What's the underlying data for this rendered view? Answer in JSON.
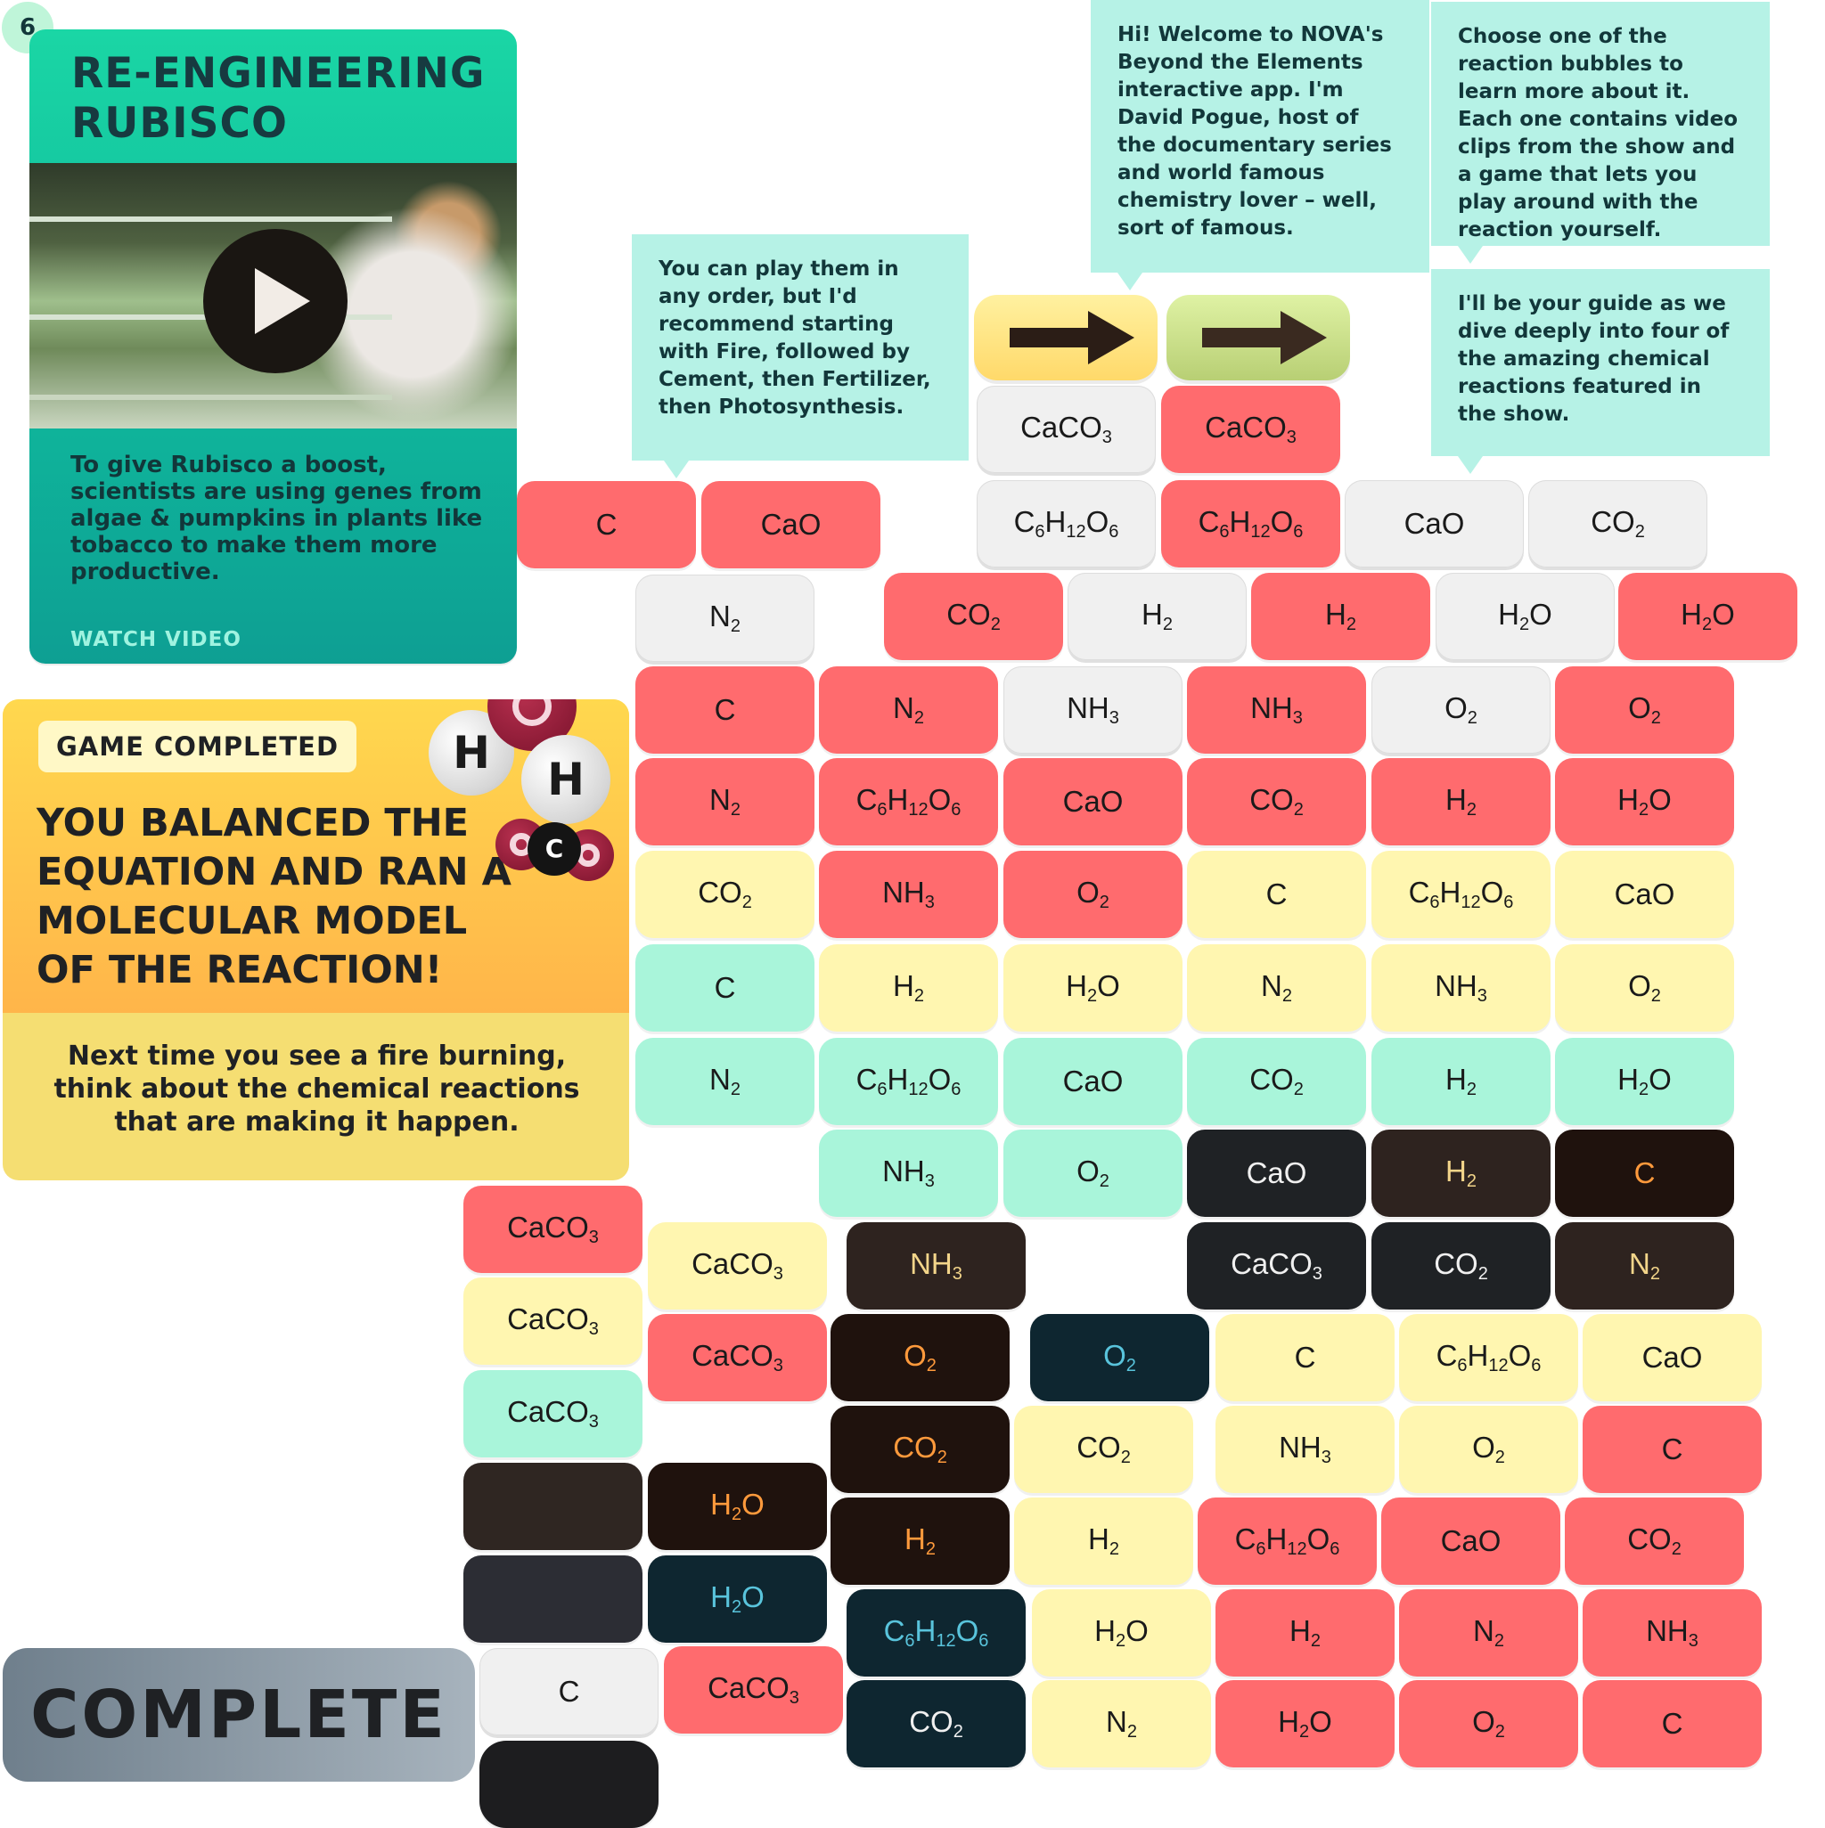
{
  "step_badge": "6",
  "video_card": {
    "title": "RE-ENGINEERING RUBISCO",
    "description": "To give Rubisco a boost, scientists are using genes from algae & pumpkins in plants like tobacco to make them more productive.",
    "watch_label": "WATCH VIDEO"
  },
  "game_card": {
    "badge": "GAME COMPLETED",
    "headline": "YOU BALANCED THE EQUATION AND RAN A MOLECULAR MODEL OF THE REACTION!",
    "body": "Next time you see a fire burning, think about the chemical reactions that are making it happen.",
    "molecules": {
      "h": "H",
      "c": "C"
    }
  },
  "complete_button": "COMPLETE",
  "bubbles": {
    "b1": [
      {
        "t": "You can play them in any order, but I'd recommend starting with "
      },
      {
        "t": "Fire",
        "b": true
      },
      {
        "t": ", followed by "
      },
      {
        "t": "Cement",
        "b": true
      },
      {
        "t": ", then "
      },
      {
        "t": "Fertilizer",
        "b": true
      },
      {
        "t": ", then "
      },
      {
        "t": "Photosynthesis",
        "b": true
      },
      {
        "t": "."
      }
    ],
    "b2": [
      {
        "t": "Hi! Welcome to NOVA's Beyond the Elements interactive app. I'm "
      },
      {
        "t": "David Pogue",
        "b": true
      },
      {
        "t": ", host of the documentary series and world famous chemistry lover – well, sort of famous."
      }
    ],
    "b3": [
      {
        "t": "Choose one of the reaction bubbles to learn more about it. Each one contains video clips from the show and a game that lets you play around with the reaction yourself."
      }
    ],
    "b4": [
      {
        "t": "I'll be your guide",
        "b": true
      },
      {
        "t": " as we dive deeply into four of the amazing chemical reactions featured in the show."
      }
    ]
  },
  "colors": {
    "red": "#ff6b6e",
    "gray": "#f0f0f0",
    "yellow": "#fff6b0",
    "mint": "#a9f5da",
    "charcoal": "#1f2225",
    "brown": "#2e231f",
    "dark_brown": "#1f120d",
    "navy": "#0e2630",
    "bubble": "#b6f2e6",
    "accent_teal": "#1ad6a5",
    "accent_orange": "#ffb54a"
  },
  "arrows": [
    {
      "icon": "right-arrow-icon",
      "style": "yellow"
    },
    {
      "icon": "right-arrow-icon",
      "style": "olive"
    }
  ],
  "tiles": [
    {
      "f": "CaCO3",
      "c": "gray"
    },
    {
      "f": "CaCO3",
      "c": "red"
    },
    {
      "f": "C6H12O6",
      "c": "gray"
    },
    {
      "f": "C6H12O6",
      "c": "red"
    },
    {
      "f": "CaO",
      "c": "gray"
    },
    {
      "f": "CO2",
      "c": "gray"
    },
    {
      "f": "C",
      "c": "red"
    },
    {
      "f": "CaO",
      "c": "red"
    },
    {
      "f": "N2",
      "c": "gray"
    },
    {
      "f": "CO2",
      "c": "red"
    },
    {
      "f": "H2",
      "c": "gray"
    },
    {
      "f": "H2",
      "c": "red"
    },
    {
      "f": "H2O",
      "c": "gray"
    },
    {
      "f": "H2O",
      "c": "red"
    },
    {
      "f": "C",
      "c": "red"
    },
    {
      "f": "N2",
      "c": "red"
    },
    {
      "f": "NH3",
      "c": "gray"
    },
    {
      "f": "NH3",
      "c": "red"
    },
    {
      "f": "O2",
      "c": "gray"
    },
    {
      "f": "O2",
      "c": "red"
    },
    {
      "f": "N2",
      "c": "red"
    },
    {
      "f": "C6H12O6",
      "c": "red"
    },
    {
      "f": "CaO",
      "c": "red"
    },
    {
      "f": "CO2",
      "c": "red"
    },
    {
      "f": "H2",
      "c": "red"
    },
    {
      "f": "H2O",
      "c": "red"
    },
    {
      "f": "CO2",
      "c": "yellow"
    },
    {
      "f": "NH3",
      "c": "red"
    },
    {
      "f": "O2",
      "c": "red"
    },
    {
      "f": "C",
      "c": "yellow"
    },
    {
      "f": "C6H12O6",
      "c": "yellow"
    },
    {
      "f": "CaO",
      "c": "yellow"
    },
    {
      "f": "C",
      "c": "mint"
    },
    {
      "f": "H2",
      "c": "yellow"
    },
    {
      "f": "H2O",
      "c": "yellow"
    },
    {
      "f": "N2",
      "c": "yellow"
    },
    {
      "f": "NH3",
      "c": "yellow"
    },
    {
      "f": "O2",
      "c": "yellow"
    },
    {
      "f": "N2",
      "c": "mint"
    },
    {
      "f": "C6H12O6",
      "c": "mint"
    },
    {
      "f": "CaO",
      "c": "mint"
    },
    {
      "f": "CO2",
      "c": "mint"
    },
    {
      "f": "H2",
      "c": "mint"
    },
    {
      "f": "H2O",
      "c": "mint"
    },
    {
      "f": "NH3",
      "c": "mint"
    },
    {
      "f": "O2",
      "c": "mint"
    },
    {
      "f": "CaO",
      "c": "charcoal"
    },
    {
      "f": "H2",
      "c": "brown"
    },
    {
      "f": "C",
      "c": "darkbrown"
    },
    {
      "f": "CaCO3",
      "c": "red"
    },
    {
      "f": "CaCO3",
      "c": "yellow"
    },
    {
      "f": "NH3",
      "c": "brown"
    },
    {
      "f": "CaCO3",
      "c": "charcoal"
    },
    {
      "f": "CO2",
      "c": "charcoal"
    },
    {
      "f": "N2",
      "c": "brown"
    },
    {
      "f": "CaCO3",
      "c": "yellow"
    },
    {
      "f": "CaCO3",
      "c": "red"
    },
    {
      "f": "O2",
      "c": "darkbrown"
    },
    {
      "f": "O2",
      "c": "navy"
    },
    {
      "f": "C",
      "c": "yellow"
    },
    {
      "f": "C6H12O6",
      "c": "yellow"
    },
    {
      "f": "CaO",
      "c": "yellow"
    },
    {
      "f": "CaCO3",
      "c": "mint"
    },
    {
      "f": "CO2",
      "c": "darkbrown"
    },
    {
      "f": "CO2",
      "c": "yellow"
    },
    {
      "f": "NH3",
      "c": "yellow"
    },
    {
      "f": "O2",
      "c": "yellow"
    },
    {
      "f": "C",
      "c": "red"
    },
    {
      "f": "",
      "c": "blank-brown"
    },
    {
      "f": "H2O",
      "c": "darkbrown"
    },
    {
      "f": "H2",
      "c": "darkbrown"
    },
    {
      "f": "H2",
      "c": "yellow"
    },
    {
      "f": "C6H12O6",
      "c": "red"
    },
    {
      "f": "CaO",
      "c": "red"
    },
    {
      "f": "CO2",
      "c": "red"
    },
    {
      "f": "",
      "c": "blank-slate"
    },
    {
      "f": "H2O",
      "c": "navy"
    },
    {
      "f": "C6H12O6",
      "c": "navy"
    },
    {
      "f": "H2O",
      "c": "yellow"
    },
    {
      "f": "H2",
      "c": "red"
    },
    {
      "f": "N2",
      "c": "red"
    },
    {
      "f": "NH3",
      "c": "red"
    },
    {
      "f": "C",
      "c": "gray"
    },
    {
      "f": "CaCO3",
      "c": "red"
    },
    {
      "f": "CO2",
      "c": "navywhite"
    },
    {
      "f": "N2",
      "c": "yellow"
    },
    {
      "f": "H2O",
      "c": "red"
    },
    {
      "f": "O2",
      "c": "red"
    },
    {
      "f": "C",
      "c": "red"
    },
    {
      "f": "",
      "c": "blank-black"
    }
  ]
}
